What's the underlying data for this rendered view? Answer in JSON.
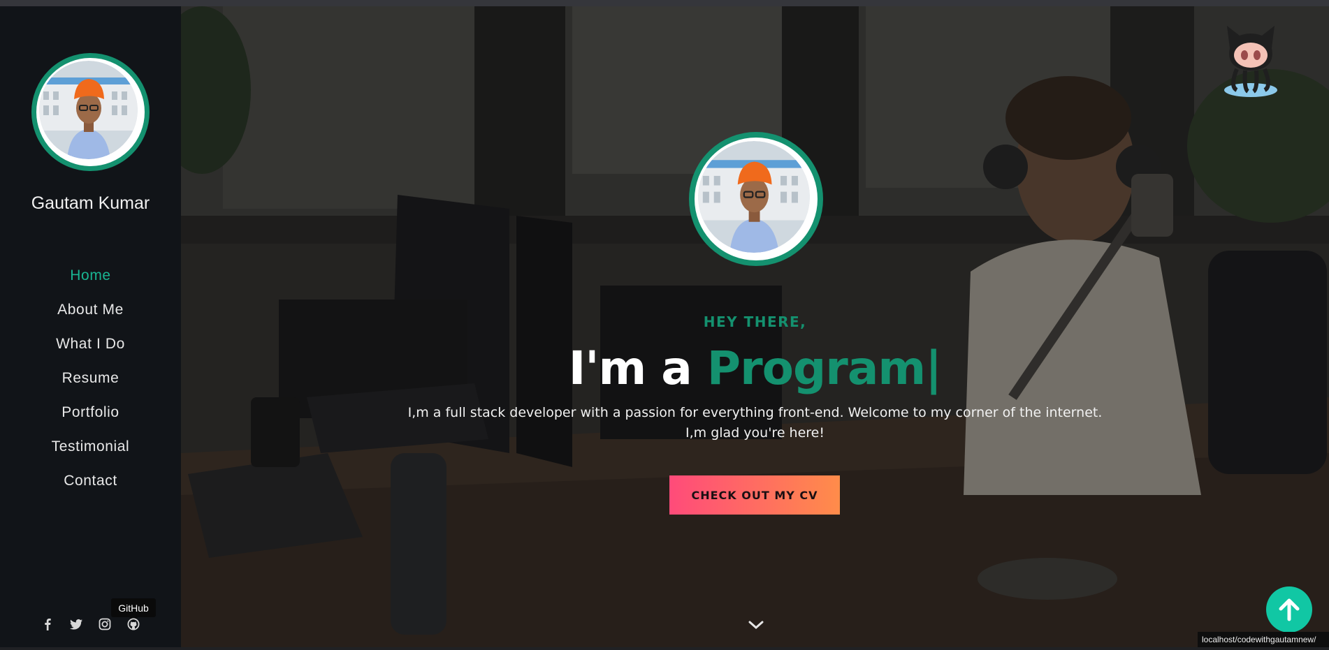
{
  "sidebar": {
    "name": "Gautam Kumar",
    "nav": [
      {
        "label": "Home",
        "active": true
      },
      {
        "label": "About Me"
      },
      {
        "label": "What I Do"
      },
      {
        "label": "Resume"
      },
      {
        "label": "Portfolio"
      },
      {
        "label": "Testimonial"
      },
      {
        "label": "Contact"
      }
    ],
    "social_icons": [
      "facebook-icon",
      "twitter-icon",
      "instagram-icon",
      "github-icon"
    ],
    "tooltip": "GitHub"
  },
  "hero": {
    "greeting": "HEY THERE,",
    "headline_prefix": "I'm a ",
    "headline_typed": "Program|",
    "intro_line1": "I,m a full stack developer with a passion for everything front-end. Welcome to my corner of the internet.",
    "intro_line2": "I,m glad you're here!",
    "cv_button": "CHECK OUT MY CV"
  },
  "status_url": "localhost/codewithgautamnew/",
  "colors": {
    "accent": "#14916f",
    "sidebar_bg": "#111418",
    "button_gradient": [
      "#ff4b7a",
      "#ff8c4a"
    ],
    "to_top_button": "#11c7a4"
  }
}
